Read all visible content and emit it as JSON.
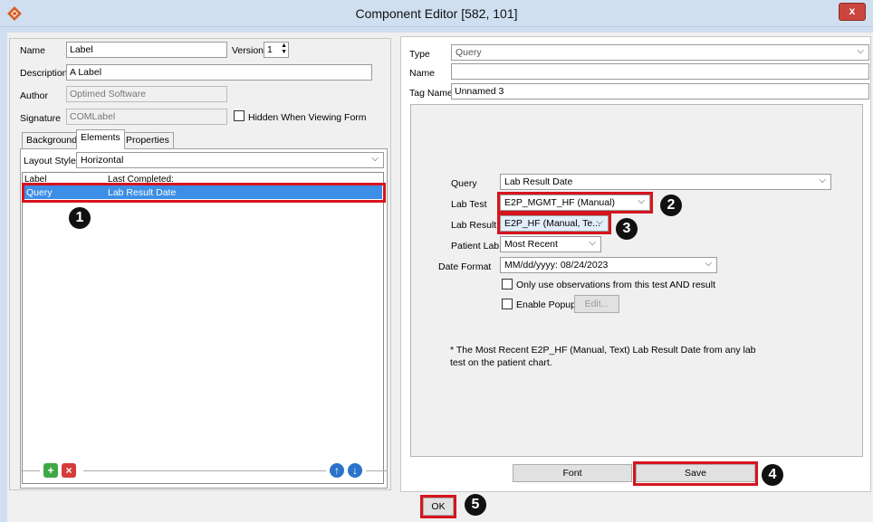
{
  "window": {
    "title": "Component Editor [582, 101]",
    "close": "x"
  },
  "left": {
    "name_label": "Name",
    "name_value": "Label",
    "version_label": "Version",
    "version_value": "1",
    "desc_label": "Description",
    "desc_value": "A Label",
    "author_label": "Author",
    "author_value": "Optimed Software",
    "sig_label": "Signature",
    "sig_value": "COMLabel",
    "hidden_label": "Hidden When Viewing Form",
    "tabs": [
      {
        "label": "Background"
      },
      {
        "label": "Elements"
      },
      {
        "label": "Properties"
      }
    ],
    "layout_label": "Layout Style",
    "layout_value": "Horizontal",
    "col_label": "Label",
    "col_last": "Last Completed:",
    "row": {
      "label": "Query",
      "value": "Lab Result Date"
    }
  },
  "right": {
    "type_label": "Type",
    "type_value": "Query",
    "name_label": "Name",
    "name_value": "",
    "tag_label": "Tag Name",
    "tag_value": "Unnamed 3",
    "query_label": "Query",
    "query_value": "Lab Result Date",
    "labtest_label": "Lab Test",
    "labtest_value": "E2P_MGMT_HF (Manual)",
    "labresult_label": "Lab Result",
    "labresult_value": "E2P_HF (Manual, Te...",
    "patientlab_label": "Patient Lab",
    "patientlab_value": "Most Recent",
    "datefmt_label": "Date Format",
    "datefmt_value": "MM/dd/yyyy: 08/24/2023",
    "only_obs_label": "Only use observations from this test AND result",
    "popup_label": "Enable Popup",
    "edit_label": "Edit...",
    "note_line1": "* The Most Recent E2P_HF (Manual, Text) Lab Result Date from any lab",
    "note_line2": "test on the patient chart.",
    "font_label": "Font",
    "save_label": "Save"
  },
  "ok_label": "OK",
  "badges": [
    "1",
    "2",
    "3",
    "4",
    "5"
  ]
}
